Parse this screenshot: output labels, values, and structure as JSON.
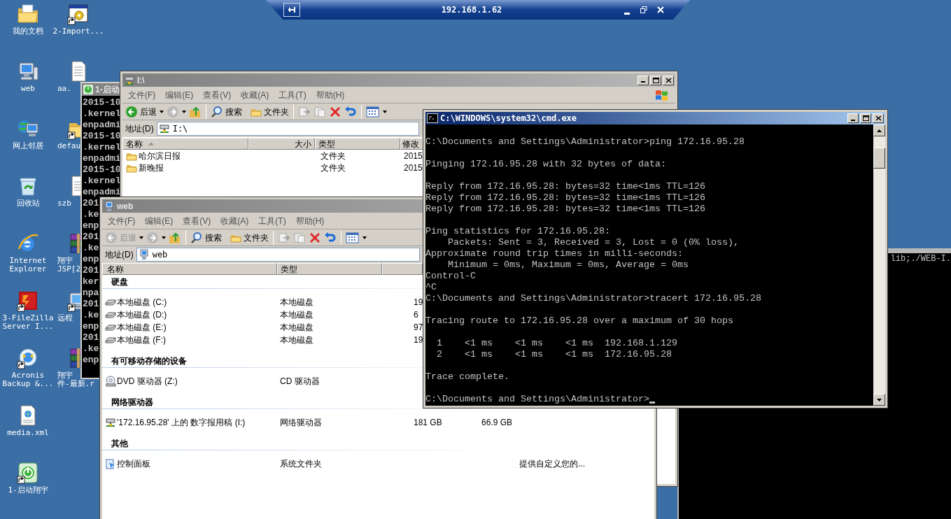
{
  "remote_bar": {
    "title": "192.168.1.62"
  },
  "desktop_icons_left": [
    {
      "label_lines": [
        "我的文档"
      ],
      "kind": "documents",
      "shortcut": false
    },
    {
      "label_lines": [
        "web"
      ],
      "kind": "computer",
      "shortcut": false
    },
    {
      "label_lines": [
        "网上邻居"
      ],
      "kind": "network",
      "shortcut": false
    },
    {
      "label_lines": [
        "回收站"
      ],
      "kind": "recycle",
      "shortcut": false
    },
    {
      "label_lines": [
        "Internet",
        "Explorer"
      ],
      "kind": "ie",
      "shortcut": false
    },
    {
      "label_lines": [
        "3-FileZilla",
        "Server I..."
      ],
      "kind": "filezilla",
      "shortcut": true
    },
    {
      "label_lines": [
        "Acronis",
        "Backup &..."
      ],
      "kind": "acronis",
      "shortcut": true
    },
    {
      "label_lines": [
        "media.xml"
      ],
      "kind": "xml",
      "shortcut": false
    },
    {
      "label_lines": [
        "1-启动翔宇"
      ],
      "kind": "launcher",
      "shortcut": true
    }
  ],
  "desktop_icons_right": [
    {
      "label_lines": [
        "2-Import..."
      ],
      "kind": "app",
      "shortcut": true
    },
    {
      "label_lines": [
        "aa."
      ],
      "kind": "textfile",
      "shortcut": false
    },
    {
      "label_lines": [
        "defau"
      ],
      "kind": "folder",
      "shortcut": true
    },
    {
      "label_lines": [
        "szb"
      ],
      "kind": "textfile",
      "shortcut": false
    },
    {
      "label_lines": [
        "翔宇",
        "JSP[2"
      ],
      "kind": "winrar",
      "shortcut": false
    },
    {
      "label_lines": [
        "远程"
      ],
      "kind": "remote",
      "shortcut": true
    },
    {
      "label_lines": [
        "翔宇",
        "件-最新.r"
      ],
      "kind": "winrar",
      "shortcut": false
    }
  ],
  "background_console": {
    "title": "1-启动",
    "lines": [
      "2015-10",
      ".kernel",
      "enpadmi",
      "2015-10",
      ".kernel",
      "enpadmi",
      "2015-10",
      ".kernel",
      "enpadmi",
      "201",
      ".ke",
      "enp",
      "201",
      ".ke",
      "enp",
      "201",
      "ker",
      "npa",
      "201",
      ".ke",
      "enp",
      "201",
      ".ke",
      "enp"
    ]
  },
  "right_console": {
    "output": "lib;./WEB-I."
  },
  "explorer_i": {
    "title": "I:\\",
    "kind": "netdrive",
    "menu": [
      "文件(F)",
      "编辑(E)",
      "查看(V)",
      "收藏(A)",
      "工具(T)",
      "帮助(H)"
    ],
    "toolbar": {
      "back": "后退",
      "back_disabled": false,
      "search": "搜索",
      "folders": "文件夹"
    },
    "address_label": "地址(D)",
    "address": "I:\\",
    "columns": [
      "名称",
      "大小",
      "类型",
      "修改"
    ],
    "rows": [
      {
        "name": "哈尔滨日报",
        "type": "文件夹",
        "modified": "2015"
      },
      {
        "name": "新晚报",
        "type": "文件夹",
        "modified": "2015"
      }
    ]
  },
  "explorer_web": {
    "title": "web",
    "kind": "computer",
    "menu": [
      "文件(F)",
      "编辑(E)",
      "查看(V)",
      "收藏(A)",
      "工具(T)",
      "帮助(H)"
    ],
    "toolbar": {
      "back": "后退",
      "back_disabled": true,
      "search": "搜索",
      "folders": "文件夹"
    },
    "address_label": "地址(D)",
    "address": "web",
    "columns": [
      "名称",
      "类型"
    ],
    "groups": [
      {
        "title": "硬盘",
        "items": [
          {
            "name": "本地磁盘 (C:)",
            "kind": "disk",
            "type": "本地磁盘",
            "size": "19"
          },
          {
            "name": "本地磁盘 (D:)",
            "kind": "disk",
            "type": "本地磁盘",
            "size": "6"
          },
          {
            "name": "本地磁盘 (E:)",
            "kind": "disk",
            "type": "本地磁盘",
            "size": "97"
          },
          {
            "name": "本地磁盘 (F:)",
            "kind": "disk",
            "type": "本地磁盘",
            "size": "19"
          }
        ]
      },
      {
        "title": "有可移动存储的设备",
        "items": [
          {
            "name": "DVD 驱动器 (Z:)",
            "kind": "dvd",
            "type": "CD 驱动器"
          }
        ]
      },
      {
        "title": "网络驱动器",
        "items": [
          {
            "name": "'172.16.95.28' 上的 数字报用稿 (I:)",
            "kind": "netdrive",
            "type": "网络驱动器",
            "size": "181 GB",
            "free": "66.9 GB"
          }
        ]
      },
      {
        "title": "其他",
        "items": [
          {
            "name": "控制面板",
            "kind": "control-panel",
            "type": "系统文件夹",
            "comment": "提供自定义您的..."
          }
        ]
      }
    ]
  },
  "cmd": {
    "title": "C:\\WINDOWS\\system32\\cmd.exe",
    "output": "C:\\Documents and Settings\\Administrator>ping 172.16.95.28\n\nPinging 172.16.95.28 with 32 bytes of data:\n\nReply from 172.16.95.28: bytes=32 time<1ms TTL=126\nReply from 172.16.95.28: bytes=32 time<1ms TTL=126\nReply from 172.16.95.28: bytes=32 time<1ms TTL=126\n\nPing statistics for 172.16.95.28:\n    Packets: Sent = 3, Received = 3, Lost = 0 (0% loss),\nApproximate round trip times in milli-seconds:\n    Minimum = 0ms, Maximum = 0ms, Average = 0ms\nControl-C\n^C\nC:\\Documents and Settings\\Administrator>tracert 172.16.95.28\n\nTracing route to 172.16.95.28 over a maximum of 30 hops\n\n  1    <1 ms    <1 ms    <1 ms  192.168.1.129\n  2    <1 ms    <1 ms    <1 ms  172.16.95.28\n\nTrace complete.\n\nC:\\Documents and Settings\\Administrator>"
  }
}
